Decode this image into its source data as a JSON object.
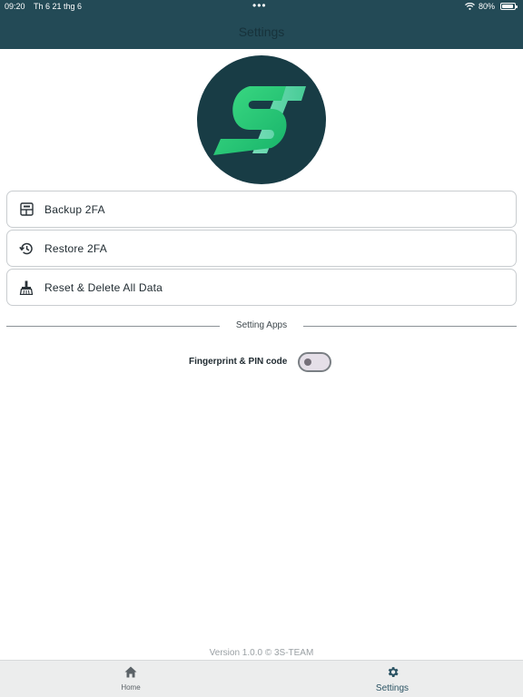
{
  "status_bar": {
    "time": "09:20",
    "date": "Th 6 21 thg 6",
    "dots": "•••",
    "battery": "80%"
  },
  "header": {
    "title": "Settings"
  },
  "menu": [
    {
      "label": "Backup 2FA",
      "icon": "backup-icon"
    },
    {
      "label": "Restore 2FA",
      "icon": "restore-history-icon"
    },
    {
      "label": "Reset & Delete All Data",
      "icon": "broom-icon"
    }
  ],
  "section": {
    "label": "Setting Apps"
  },
  "toggle": {
    "label": "Fingerprint & PIN code",
    "enabled": false
  },
  "footer": {
    "version": "Version 1.0.0 © 3S-TEAM"
  },
  "tabs": [
    {
      "label": "Home",
      "icon": "home-icon",
      "active": false
    },
    {
      "label": "Settings",
      "icon": "gear-icon",
      "active": true
    }
  ],
  "colors": {
    "header": "#234a56",
    "logo_bg": "#183c45",
    "logo_accent": "#3ddc84",
    "active_tab": "#2b5363"
  }
}
